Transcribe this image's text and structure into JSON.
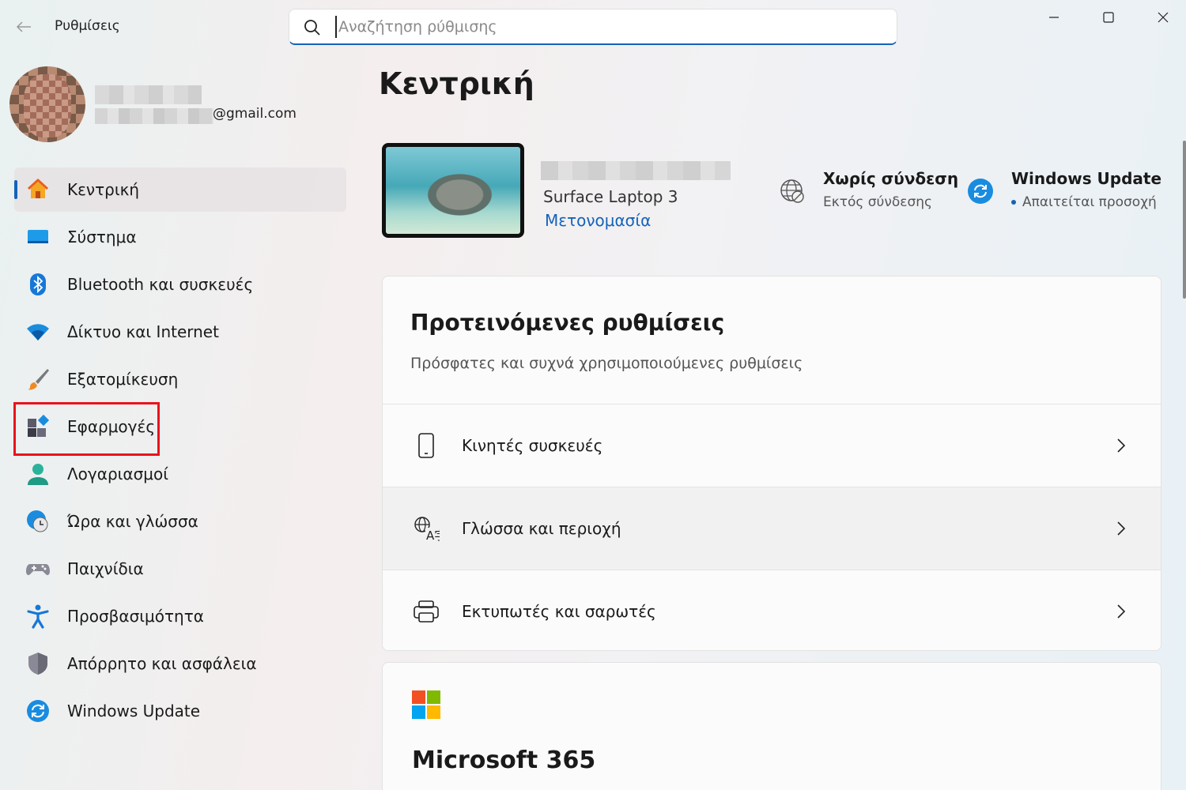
{
  "window": {
    "title": "Ρυθμίσεις"
  },
  "search": {
    "placeholder": "Αναζήτηση ρύθμισης",
    "value": ""
  },
  "profile": {
    "email_suffix": "@gmail.com"
  },
  "sidebar": {
    "items": [
      {
        "label": "Κεντρική",
        "icon": "home-icon",
        "active": true
      },
      {
        "label": "Σύστημα",
        "icon": "system-icon"
      },
      {
        "label": "Bluetooth και συσκευές",
        "icon": "bluetooth-icon"
      },
      {
        "label": "Δίκτυο και Internet",
        "icon": "wifi-icon"
      },
      {
        "label": "Εξατομίκευση",
        "icon": "brush-icon"
      },
      {
        "label": "Εφαρμογές",
        "icon": "apps-icon"
      },
      {
        "label": "Λογαριασμοί",
        "icon": "account-icon"
      },
      {
        "label": "Ώρα και γλώσσα",
        "icon": "time-language-icon"
      },
      {
        "label": "Παιχνίδια",
        "icon": "gamepad-icon"
      },
      {
        "label": "Προσβασιμότητα",
        "icon": "accessibility-icon"
      },
      {
        "label": "Απόρρητο και ασφάλεια",
        "icon": "shield-icon"
      },
      {
        "label": "Windows Update",
        "icon": "update-icon"
      }
    ]
  },
  "main": {
    "title": "Κεντρική",
    "device": {
      "model": "Surface Laptop 3",
      "rename_label": "Μετονομασία"
    },
    "status": [
      {
        "title": "Χωρίς σύνδεση",
        "subtitle": "Εκτός σύνδεσης",
        "icon": "no-network-icon"
      },
      {
        "title": "Windows Update",
        "subtitle": "Απαιτείται προσοχή",
        "icon": "update-icon"
      }
    ],
    "recommended": {
      "title": "Προτεινόμενες ρυθμίσεις",
      "subtitle": "Πρόσφατες και συχνά χρησιμοποιούμενες ρυθμίσεις",
      "items": [
        {
          "label": "Κινητές συσκευές",
          "icon": "phone-icon"
        },
        {
          "label": "Γλώσσα και περιοχή",
          "icon": "language-icon"
        },
        {
          "label": "Εκτυπωτές και σαρωτές",
          "icon": "printer-icon"
        }
      ]
    },
    "m365": {
      "title": "Microsoft 365"
    }
  },
  "colors": {
    "accent": "#1463b8",
    "highlight": "#e8141c"
  }
}
